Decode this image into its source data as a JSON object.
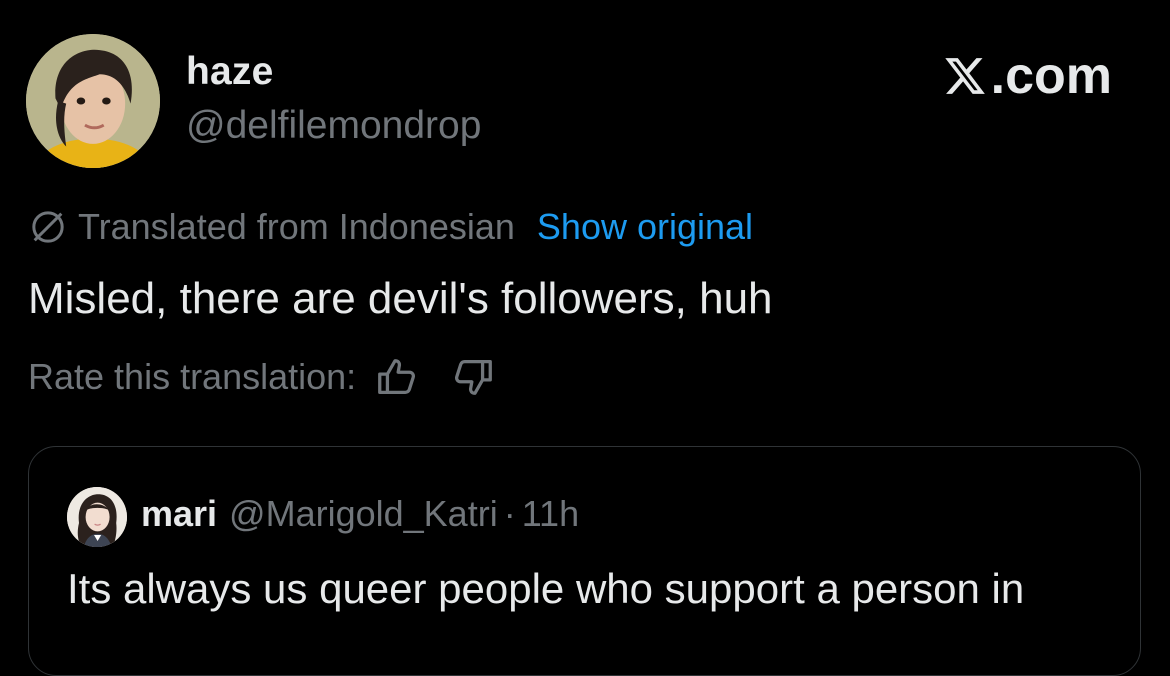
{
  "tweet": {
    "display_name": "haze",
    "handle": "@delfilemondrop",
    "translated_label": "Translated from Indonesian",
    "show_original_label": "Show original",
    "text": "Misled, there are devil's followers, huh",
    "rate_label": "Rate this translation:",
    "icons": [
      "globe-icon",
      "thumbs-up-icon",
      "thumbs-down-icon"
    ]
  },
  "brand": {
    "label": ".com",
    "icon": "x-logo-icon"
  },
  "quote": {
    "display_name": "mari",
    "handle": "@Marigold_Katri",
    "separator": "·",
    "time": "11h",
    "text": "Its always us queer people who support a person in"
  },
  "colors": {
    "background": "#000000",
    "text_primary": "#e7e9ea",
    "text_secondary": "#71767b",
    "link": "#1d9bf0",
    "border": "#2f3336"
  }
}
